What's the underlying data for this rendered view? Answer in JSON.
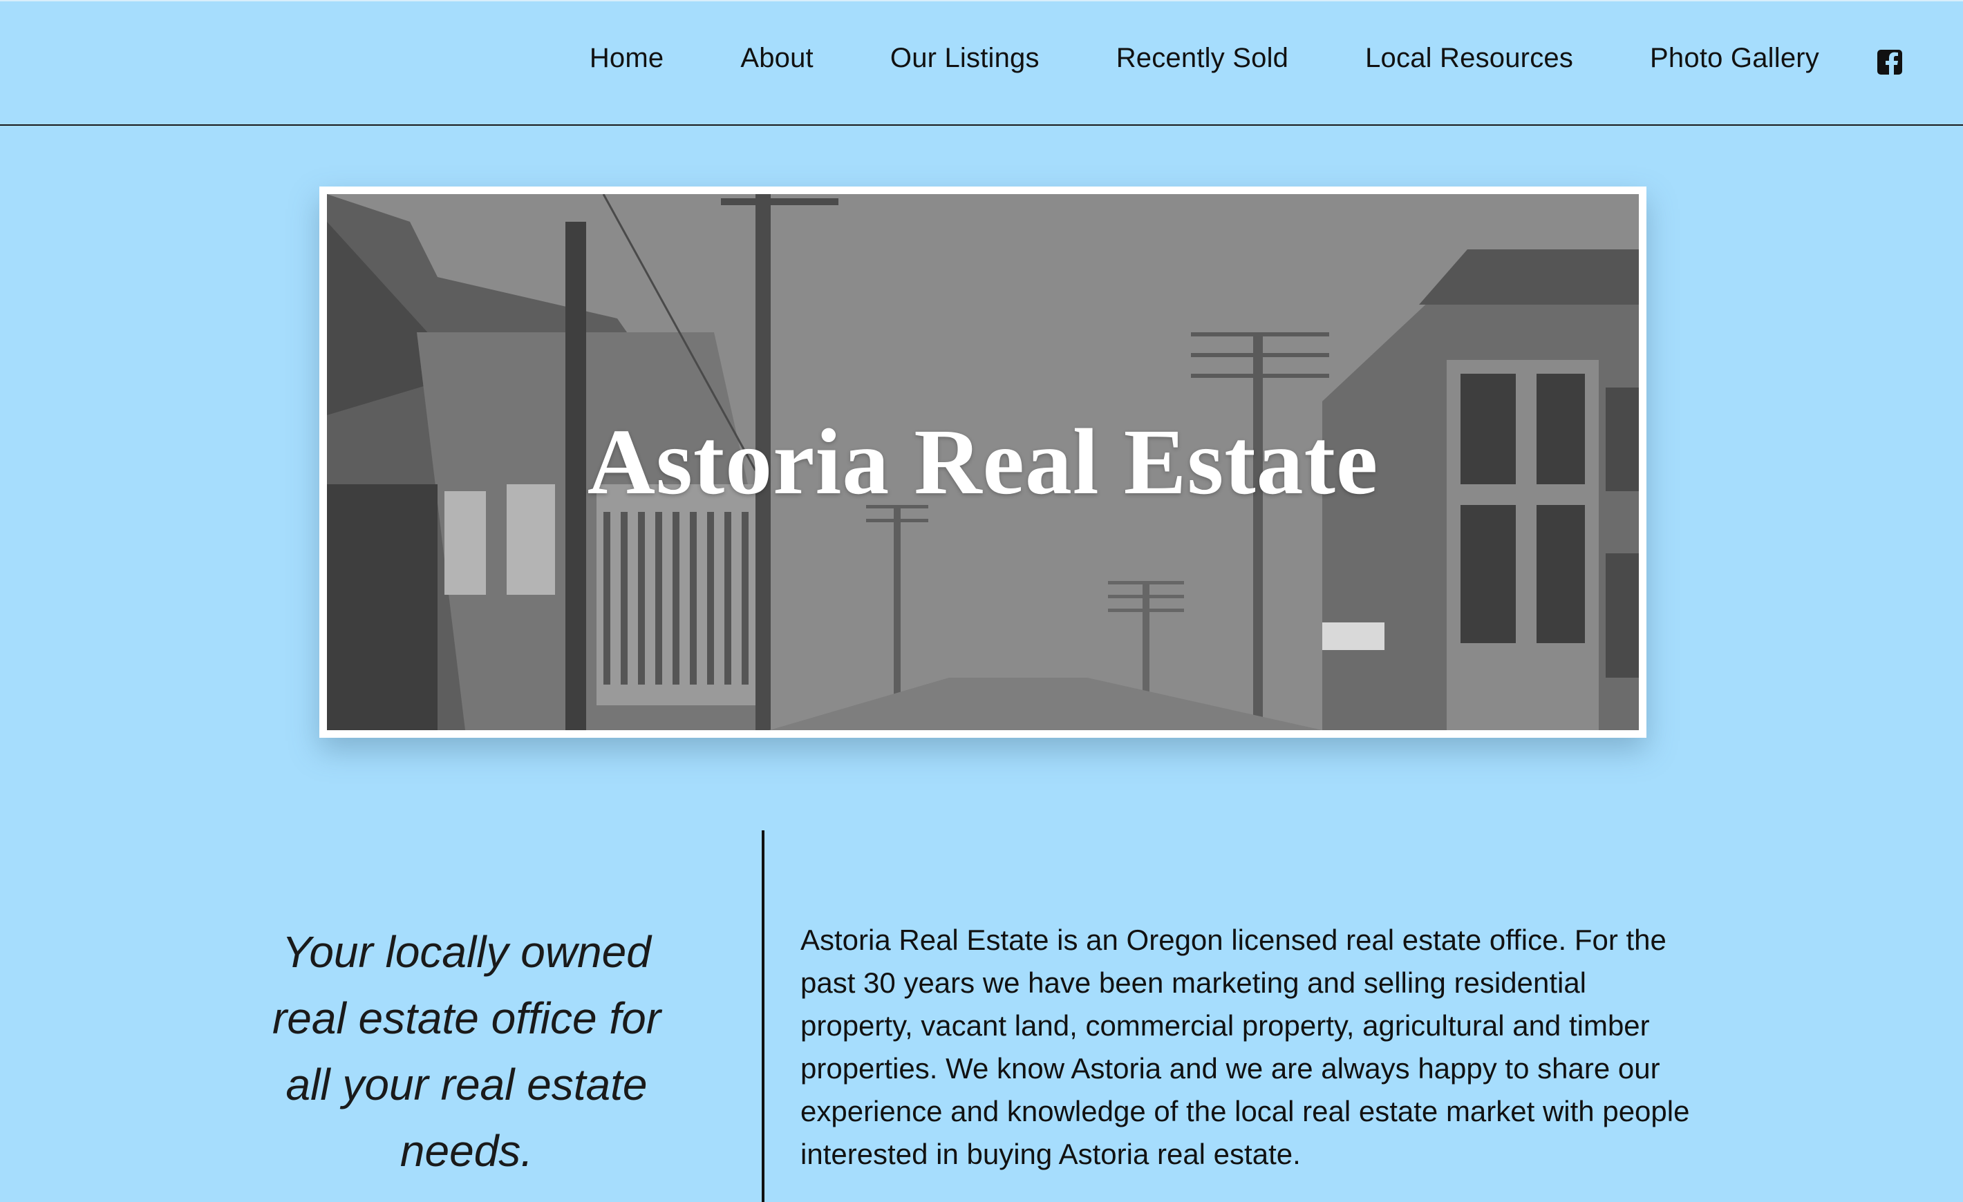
{
  "nav": {
    "items": [
      {
        "label": "Home"
      },
      {
        "label": "About"
      },
      {
        "label": "Our Listings"
      },
      {
        "label": "Recently Sold"
      },
      {
        "label": "Local Resources"
      },
      {
        "label": "Photo Gallery"
      }
    ],
    "social_icon": "facebook-icon"
  },
  "hero": {
    "title": "Astoria Real Estate",
    "image_description_icon": "historic-street-photo"
  },
  "content": {
    "tagline": "Your locally owned real estate office for all your real estate needs.",
    "description": "Astoria Real Estate is an Oregon licensed real estate office. For the past 30 years we have been marketing and selling residential property, vacant land, commercial property, agricultural and timber properties. We know Astoria and we are always happy to share our experience and knowledge of the local real estate market with people interested in buying Astoria real estate."
  },
  "colors": {
    "background": "#a6ddfd",
    "text": "#111111",
    "frame": "#ffffff"
  }
}
